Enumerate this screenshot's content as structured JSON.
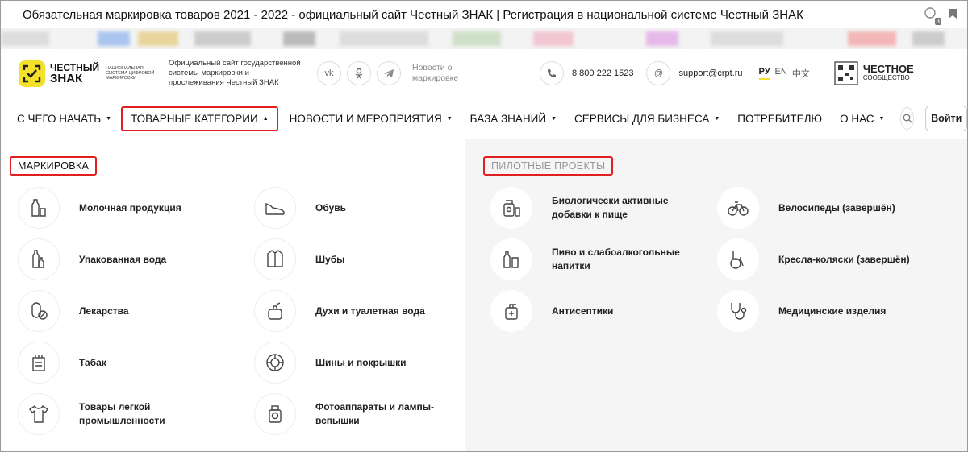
{
  "window": {
    "title": "Обязательная маркировка товаров 2021 - 2022 - официальный сайт Честный ЗНАК | Регистрация в национальной системе Честный ЗНАК",
    "badge": "3"
  },
  "header": {
    "logo_line1": "ЧЕСТНЫЙ",
    "logo_line2": "ЗНАК",
    "logo_sub": "Национальная система цифровой маркировки",
    "official": "Официальный сайт государственной системы маркировки и прослеживания Честный ЗНАК",
    "social": [
      "vk-icon",
      "ok-icon",
      "telegram-icon"
    ],
    "news": "Новости о маркировке",
    "phone": "8 800 222 1523",
    "email": "support@crpt.ru",
    "langs": [
      "РУ",
      "EN",
      "中文"
    ],
    "cs_line1": "ЧЕСТНОЕ",
    "cs_line2": "СООБЩЕСТВО"
  },
  "nav": {
    "items": [
      "С ЧЕГО НАЧАТЬ",
      "ТОВАРНЫЕ КАТЕГОРИИ",
      "НОВОСТИ И МЕРОПРИЯТИЯ",
      "БАЗА ЗНАНИЙ",
      "СЕРВИСЫ ДЛЯ БИЗНЕСА",
      "ПОТРЕБИТЕЛЮ",
      "О НАС"
    ],
    "login": "Войти"
  },
  "dropdown": {
    "marking_title": "МАРКИРОВКА",
    "pilot_title": "ПИЛОТНЫЕ ПРОЕКТЫ",
    "marking": [
      "Молочная продукция",
      "Обувь",
      "Упакованная вода",
      "Шубы",
      "Лекарства",
      "Духи и туалетная вода",
      "Табак",
      "Шины и покрышки",
      "Товары легкой промышленности",
      "Фотоаппараты и лампы-вспышки"
    ],
    "pilot": [
      "Биологически активные добавки к пище",
      "Велосипеды (завершён)",
      "Пиво и слабоалкогольные напитки",
      "Кресла-коляски (завершён)",
      "Антисептики",
      "Медицинские изделия"
    ]
  }
}
